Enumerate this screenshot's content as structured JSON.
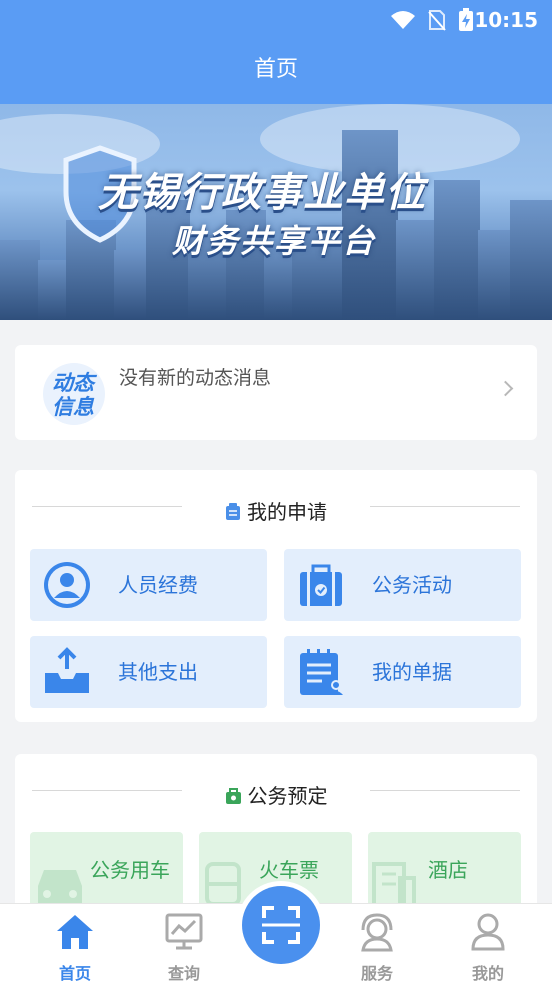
{
  "status_bar": {
    "time": "10:15",
    "icons": [
      "wifi-icon",
      "no-sim-icon",
      "battery-charging-icon"
    ]
  },
  "nav": {
    "title": "首页"
  },
  "banner": {
    "title_line1": "无锡行政事业单位",
    "title_line2": "财务共享平台"
  },
  "news": {
    "logo_line1": "动态",
    "logo_line2": "信息",
    "message": "没有新的动态消息"
  },
  "my_application": {
    "title": "我的申请",
    "items": [
      {
        "label": "人员经费",
        "icon": "person-icon"
      },
      {
        "label": "公务活动",
        "icon": "briefcase-icon"
      },
      {
        "label": "其他支出",
        "icon": "inbox-upload-icon"
      },
      {
        "label": "我的单据",
        "icon": "document-list-icon"
      }
    ]
  },
  "official_booking": {
    "title": "公务预定",
    "items": [
      {
        "label": "公务用车",
        "icon": "car-icon"
      },
      {
        "label": "火车票",
        "icon": "train-icon"
      },
      {
        "label": "酒店",
        "icon": "hotel-icon"
      }
    ]
  },
  "tab_bar": {
    "items": [
      {
        "label": "首页",
        "icon": "home-icon",
        "active": true
      },
      {
        "label": "查询",
        "icon": "chart-monitor-icon",
        "active": false
      },
      {
        "label": "",
        "icon": "scan-icon",
        "active": false
      },
      {
        "label": "服务",
        "icon": "customer-service-icon",
        "active": false
      },
      {
        "label": "我的",
        "icon": "user-icon",
        "active": false
      }
    ]
  },
  "colors": {
    "primary": "#5a9cf4",
    "tile_blue_bg": "#e3eefc",
    "tile_blue_text": "#2b74d9",
    "tile_green_bg": "#e1f4e4",
    "tile_green_text": "#3aa55a"
  }
}
